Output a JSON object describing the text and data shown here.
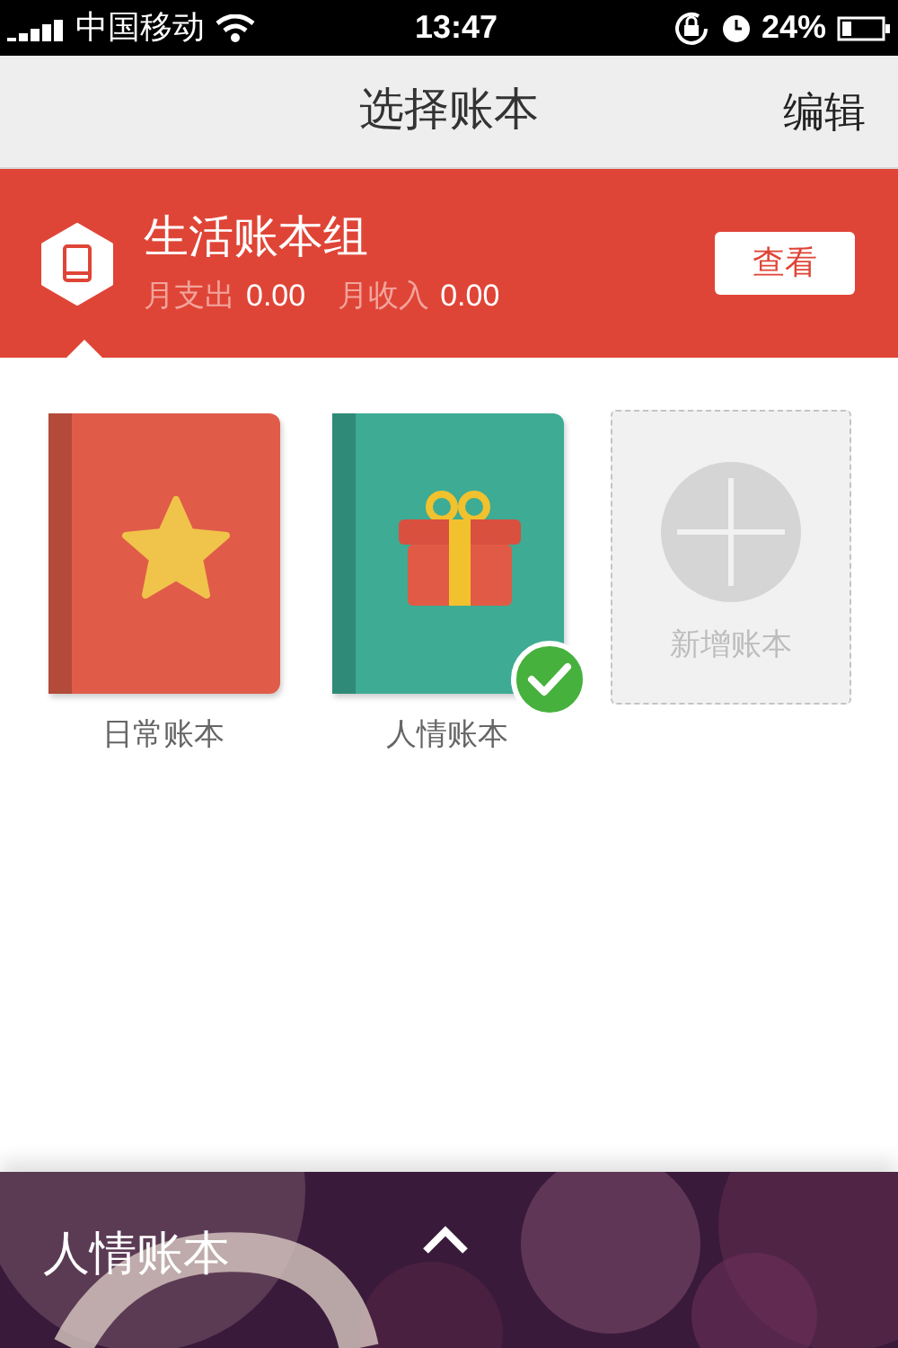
{
  "status_bar": {
    "carrier": "中国移动",
    "time": "13:47",
    "battery": "24%"
  },
  "header": {
    "title": "选择账本",
    "edit_button": "编辑"
  },
  "group": {
    "name": "生活账本组",
    "expense_label": "月支出",
    "expense_value": "0.00",
    "income_label": "月收入",
    "income_value": "0.00",
    "view_button": "查看"
  },
  "books": [
    {
      "name": "日常账本",
      "kind": "star",
      "selected": false
    },
    {
      "name": "人情账本",
      "kind": "gift",
      "selected": true
    }
  ],
  "add_book": {
    "label": "新增账本"
  },
  "bottom_bar": {
    "current_book": "人情账本"
  }
}
